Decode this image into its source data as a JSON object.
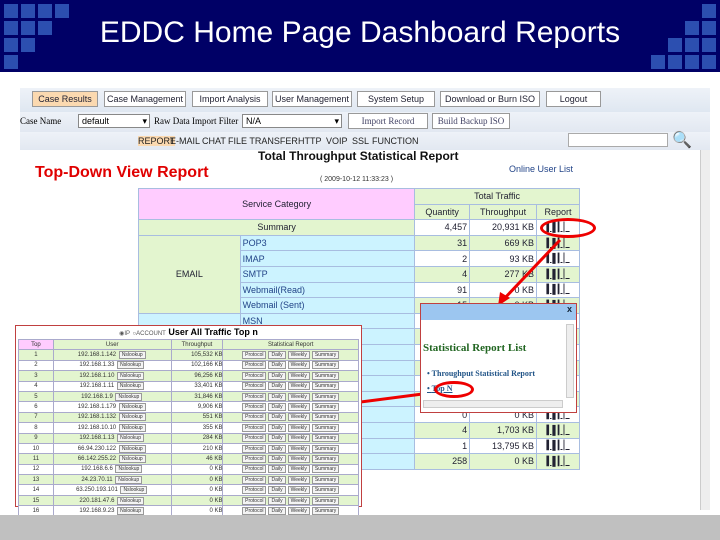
{
  "slide": {
    "title": "EDDC Home Page Dashboard Reports",
    "caption": "Top-Down View Report"
  },
  "nav": [
    "Case Results",
    "Case Management",
    "Import Analysis",
    "User Management",
    "System Setup",
    "Download or Burn ISO",
    "Logout"
  ],
  "toolbar": {
    "case_label": "Case Name",
    "case_value": "default",
    "filter_label": "Raw Data Import Filter",
    "filter_value": "N/A",
    "import_btn": "Import Record",
    "backup_btn": "Build Backup ISO"
  },
  "tabs": [
    "REPORT",
    "E-MAIL",
    "CHAT",
    "FILE TRANSFER",
    "HTTP",
    "VOIP",
    "SSL",
    "FUNCTION"
  ],
  "report": {
    "title": "Total Throughput Statistical Report",
    "timestamp": "( 2009-10-12 11:33:23 )",
    "online_link": "Online User List",
    "headers": {
      "category": "Service Category",
      "total": "Total Traffic",
      "quantity": "Quantity",
      "throughput": "Throughput",
      "report": "Report"
    },
    "summary": {
      "label": "Summary",
      "quantity": "4,457",
      "throughput": "20,931 KB"
    },
    "group": "EMAIL",
    "rows": [
      {
        "name": "POP3",
        "quantity": "31",
        "throughput": "669 KB"
      },
      {
        "name": "IMAP",
        "quantity": "2",
        "throughput": "93 KB"
      },
      {
        "name": "SMTP",
        "quantity": "4",
        "throughput": "277 KB"
      },
      {
        "name": "Webmail(Read)",
        "quantity": "91",
        "throughput": "0 KB"
      },
      {
        "name": "Webmail (Sent)",
        "quantity": "15",
        "throughput": "0 KB"
      },
      {
        "name": "MSN",
        "quantity": "",
        "throughput": ""
      },
      {
        "name": "",
        "quantity": "",
        "throughput": ""
      },
      {
        "name": "",
        "quantity": "",
        "throughput": ""
      },
      {
        "name": "",
        "quantity": "",
        "throughput": ""
      },
      {
        "name": "",
        "quantity": "",
        "throughput": ""
      },
      {
        "name": "",
        "quantity": "0",
        "throughput": "0 KB"
      },
      {
        "name": "",
        "quantity": "0",
        "throughput": "0 KB"
      },
      {
        "name": "",
        "quantity": "4",
        "throughput": "1,703 KB"
      },
      {
        "name": "",
        "quantity": "1",
        "throughput": "13,795 KB"
      },
      {
        "name": "",
        "quantity": "258",
        "throughput": "0 KB"
      }
    ],
    "report_icon": "bar-chart-icon"
  },
  "popup": {
    "close": "x",
    "title": "Statistical Report List",
    "items": [
      "Throughput Statistical Report",
      "Top N"
    ]
  },
  "topn": {
    "radio_ip": "IP",
    "radio_account": "ACCOUNT",
    "title": "User All Traffic Top n",
    "headers": [
      "Top",
      "User",
      "Throughput",
      "Statistical Report"
    ],
    "button": "Nslookup",
    "actions": [
      "Protocol",
      "Daily",
      "Weekly",
      "Summary"
    ],
    "rows": [
      [
        "1",
        "192.168.1.142",
        "105,532 KB"
      ],
      [
        "2",
        "192.168.1.33",
        "102,166 KB"
      ],
      [
        "3",
        "192.168.1.10",
        "96,256 KB"
      ],
      [
        "4",
        "192.168.1.11",
        "33,401 KB"
      ],
      [
        "5",
        "192.168.1.9",
        "31,846 KB"
      ],
      [
        "6",
        "192.168.1.179",
        "9,906 KB"
      ],
      [
        "7",
        "192.168.1.132",
        "551 KB"
      ],
      [
        "8",
        "192.168.10.10",
        "355 KB"
      ],
      [
        "9",
        "192.168.1.13",
        "284 KB"
      ],
      [
        "10",
        "66.94.230.122",
        "210 KB"
      ],
      [
        "11",
        "66.142.255.22",
        "46 KB"
      ],
      [
        "12",
        "192.168.6.6",
        "0 KB"
      ],
      [
        "13",
        "24.23.70.11",
        "0 KB"
      ],
      [
        "14",
        "63.250.193.101",
        "0 KB"
      ],
      [
        "15",
        "220.181.47.6",
        "0 KB"
      ],
      [
        "16",
        "192.168.9.23",
        "0 KB"
      ]
    ]
  },
  "colors": {
    "banner": "#000066",
    "accent": "#e00000",
    "caption": "#e00000"
  }
}
